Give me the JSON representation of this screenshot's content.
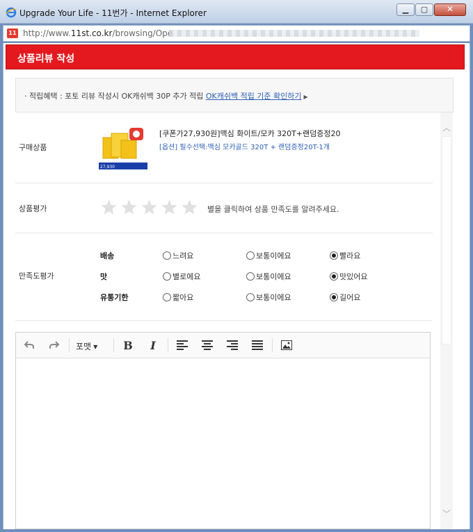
{
  "window": {
    "title": "Upgrade Your Life - 11번가 - Internet Explorer",
    "url_domain": "http://www.",
    "url_host": "11st.co.kr",
    "url_path": "/browsing/Ope",
    "site_icon_text": "11"
  },
  "header": {
    "title": "상품리뷰 작성"
  },
  "notice": {
    "text": "· 적립혜택 : 포토 리뷰 작성시 OK캐쉬백 30P 추가 적립",
    "link": "OK캐쉬백 적립 기준 확인하기"
  },
  "product": {
    "label": "구매상품",
    "name": "[쿠폰가27,930원]맥심 화이트/모카 320T+랜덤증정20",
    "option": "[옵션] 필수선택:맥심 모카골드 320T + 랜덤증정20T-1개"
  },
  "rating": {
    "label": "상품평가",
    "stars": 5,
    "selected": 0,
    "hint": "별을 클릭하여 상품 만족도를 알려주세요."
  },
  "satisfaction": {
    "label": "만족도평가",
    "rows": [
      {
        "category": "배송",
        "options": [
          "느려요",
          "보통이에요",
          "빨라요"
        ],
        "selected": 2
      },
      {
        "category": "맛",
        "options": [
          "별로에요",
          "보통이에요",
          "맛있어요"
        ],
        "selected": 2
      },
      {
        "category": "유통기한",
        "options": [
          "짧아요",
          "보통이에요",
          "길어요"
        ],
        "selected": 2
      }
    ]
  },
  "editor": {
    "format_label": "포맷"
  },
  "colors": {
    "brand_red": "#e3191f",
    "link_blue": "#2d5fb4",
    "star_gray": "#e0e0e0"
  }
}
